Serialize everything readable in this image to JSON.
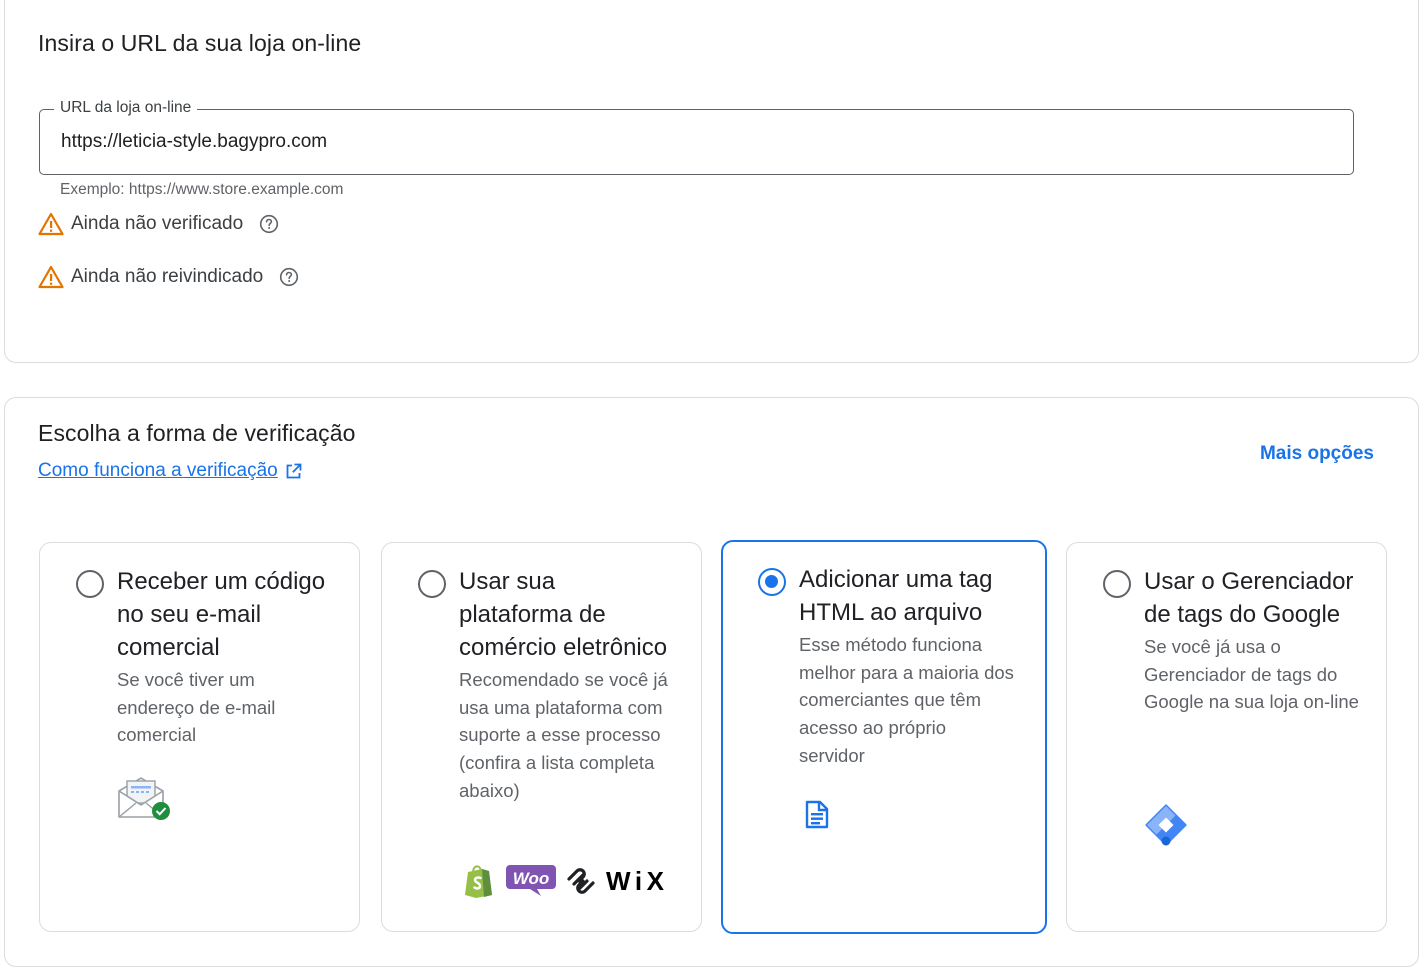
{
  "url_card": {
    "title": "Insira o URL da sua loja on-line",
    "field_label": "URL da loja on-line",
    "field_value": "https://leticia-style.bagypro.com",
    "helper_text": "Exemplo: https://www.store.example.com",
    "statuses": [
      {
        "label": "Ainda não verificado",
        "icon": "warning-icon",
        "help_icon": "help-circle-icon"
      },
      {
        "label": "Ainda não reivindicado",
        "icon": "warning-icon",
        "help_icon": "help-circle-icon"
      }
    ]
  },
  "verify_card": {
    "title": "Escolha a forma de verificação",
    "how_link": "Como funciona a verificação",
    "more_options": "Mais opções",
    "options": [
      {
        "title": "Receber um código no seu e-mail comercial",
        "description": "Se você tiver um endereço de e-mail comercial",
        "icon": "email-check-icon",
        "selected": false
      },
      {
        "title": "Usar sua plataforma de comércio eletrônico",
        "description": "Recomendado se você já usa uma plataforma com suporte a esse processo (confira a lista completa abaixo)",
        "icons": [
          "shopify-logo",
          "woocommerce-logo",
          "squarespace-logo",
          "wix-logo"
        ],
        "logo_text": {
          "woo": "Woo",
          "wix": "WiX"
        },
        "selected": false
      },
      {
        "title": "Adicionar uma tag HTML ao arquivo",
        "description": "Esse método funciona melhor para a maioria dos comerciantes que têm acesso ao próprio servidor",
        "icon": "document-icon",
        "selected": true
      },
      {
        "title": "Usar o Gerenciador de tags do Google",
        "description": "Se você já usa o Gerenciador de tags do Google na sua loja on-line",
        "icon": "tag-manager-icon",
        "selected": false
      }
    ]
  },
  "colors": {
    "accent": "#1a73e8",
    "warning": "#e37400",
    "border": "#dadce0",
    "text": "#202124",
    "secondary_text": "#5f6368"
  }
}
